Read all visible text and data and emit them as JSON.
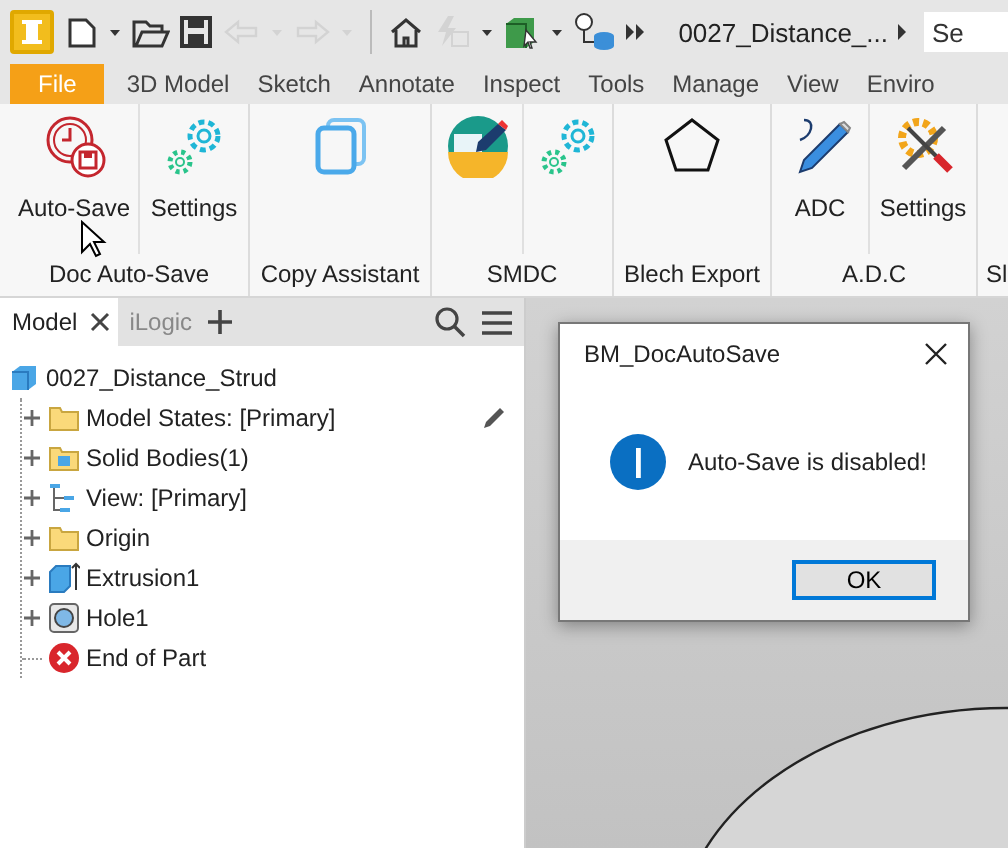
{
  "quick_access": [
    {
      "kind": "new",
      "disabled": false
    },
    {
      "kind": "caret",
      "disabled": false
    },
    {
      "kind": "open",
      "disabled": false
    },
    {
      "kind": "save",
      "disabled": false
    },
    {
      "kind": "undo",
      "disabled": true
    },
    {
      "kind": "caret",
      "disabled": true
    },
    {
      "kind": "redo",
      "disabled": true
    },
    {
      "kind": "caret",
      "disabled": true
    },
    {
      "kind": "separator",
      "disabled": false
    },
    {
      "kind": "home",
      "disabled": false
    },
    {
      "kind": "update",
      "disabled": true
    },
    {
      "kind": "caret",
      "disabled": false
    },
    {
      "kind": "box",
      "disabled": false
    },
    {
      "kind": "caret",
      "disabled": false
    },
    {
      "kind": "db",
      "disabled": false
    },
    {
      "kind": "more",
      "disabled": false
    }
  ],
  "document_title": "0027_Distance_...",
  "search": {
    "placeholder": "Se"
  },
  "ribbon_tabs": [
    {
      "label": "File",
      "kind": "file",
      "selected": false
    },
    {
      "label": "3D Model",
      "kind": "tab",
      "selected": false
    },
    {
      "label": "Sketch",
      "kind": "tab",
      "selected": false
    },
    {
      "label": "Annotate",
      "kind": "tab",
      "selected": false
    },
    {
      "label": "Inspect",
      "kind": "tab",
      "selected": false
    },
    {
      "label": "Tools",
      "kind": "tab",
      "selected": false
    },
    {
      "label": "Manage",
      "kind": "tab",
      "selected": false
    },
    {
      "label": "View",
      "kind": "tab",
      "selected": false
    },
    {
      "label": "Enviro",
      "kind": "tab",
      "selected": false
    }
  ],
  "ribbon_panels": [
    {
      "label": "Doc Auto-Save",
      "buttons": [
        {
          "label": "Auto-Save",
          "kind": "autosave"
        },
        {
          "label": "Settings",
          "kind": "gears"
        }
      ]
    },
    {
      "label": "Copy Assistant",
      "buttons": [
        {
          "kind": "copy"
        }
      ]
    },
    {
      "label": "SMDC",
      "buttons": [
        {
          "kind": "smdc"
        },
        {
          "kind": "gears"
        }
      ]
    },
    {
      "label": "Blech Export",
      "buttons": [
        {
          "kind": "pentagon"
        }
      ]
    },
    {
      "label": "A.D.C",
      "buttons": [
        {
          "label": "ADC",
          "kind": "pencil"
        },
        {
          "label": "Settings",
          "kind": "tools"
        }
      ]
    },
    {
      "label": "Sl"
    }
  ],
  "browser": {
    "tabs": [
      {
        "label": "Model",
        "selected": true,
        "closable": true
      },
      {
        "label": "iLogic",
        "selected": false,
        "closable": false
      }
    ],
    "tree": {
      "label": "0027_Distance_Strud",
      "kind": "part",
      "children": [
        {
          "label": "Model States: [Primary]",
          "kind": "folder",
          "expandable": true,
          "editable": true
        },
        {
          "label": "Solid Bodies(1)",
          "kind": "bodies",
          "expandable": true,
          "editable": false
        },
        {
          "label": "View: [Primary]",
          "kind": "view",
          "expandable": true,
          "editable": false
        },
        {
          "label": "Origin",
          "kind": "folder",
          "expandable": true,
          "editable": false
        },
        {
          "label": "Extrusion1",
          "kind": "extrusion",
          "expandable": true,
          "editable": false
        },
        {
          "label": "Hole1",
          "kind": "hole",
          "expandable": true,
          "editable": false
        },
        {
          "label": "End of Part",
          "kind": "end",
          "expandable": false,
          "editable": false
        }
      ]
    }
  },
  "dialog": {
    "title": "BM_DocAutoSave",
    "message": "Auto-Save is disabled!",
    "button": "OK"
  }
}
